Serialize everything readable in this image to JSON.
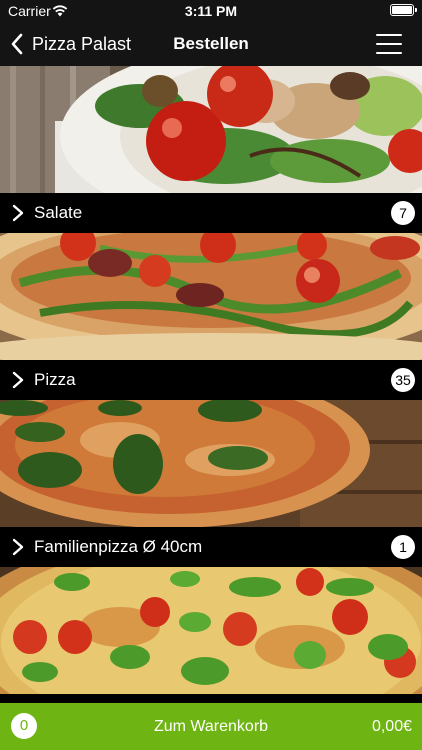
{
  "status_bar": {
    "carrier": "Carrier",
    "time": "3:11 PM"
  },
  "nav": {
    "back_label": "Pizza Palast",
    "title": "Bestellen"
  },
  "categories": [
    {
      "label": "Salate",
      "count": "7",
      "photo": "salad-photo"
    },
    {
      "label": "Pizza",
      "count": "35",
      "photo": "arugula-pizza-photo"
    },
    {
      "label": "Familienpizza Ø 40cm",
      "count": "1",
      "photo": "margherita-pizza-photo"
    },
    {
      "label": "",
      "count": "",
      "photo": "basil-tomato-pizza-photo"
    }
  ],
  "cart": {
    "count": "0",
    "label": "Zum Warenkorb",
    "total": "0,00€"
  },
  "colors": {
    "accent": "#6eb412",
    "bar": "#000000",
    "navbar": "#141414"
  }
}
